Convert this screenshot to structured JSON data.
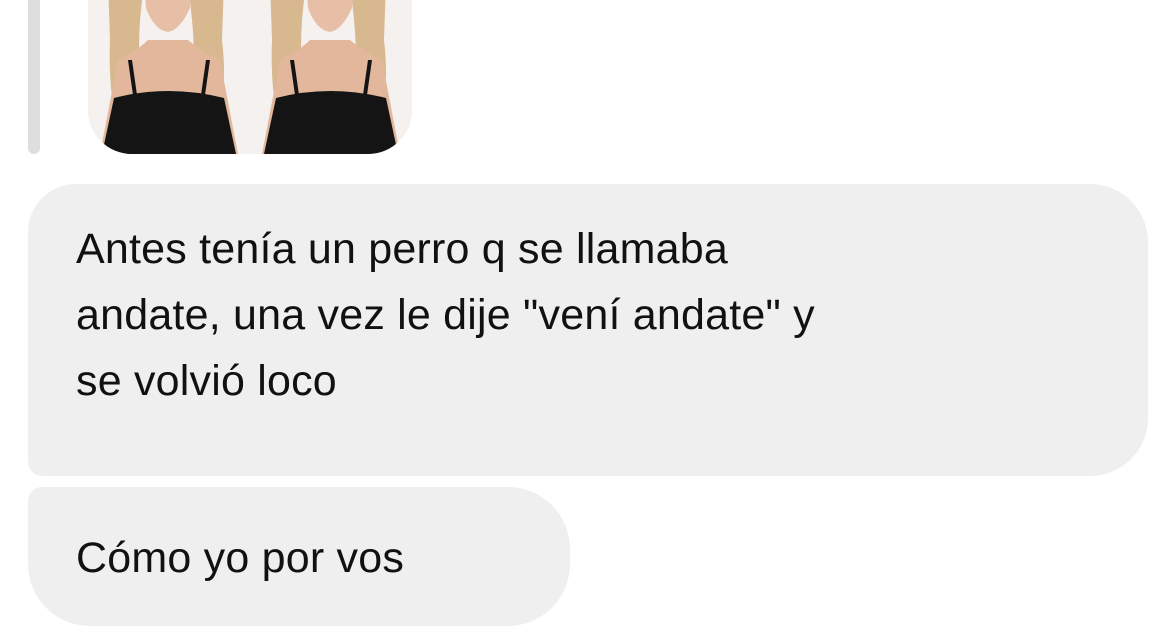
{
  "conversation": {
    "attachment": {
      "icon": "photo-icon"
    },
    "messages": [
      {
        "lines": [
          "Antes tenía un perro q se llamaba",
          "andate, una vez le dije \"vení andate\" y",
          "se volvió loco"
        ]
      },
      {
        "lines": [
          "Cómo yo por vos"
        ]
      }
    ]
  },
  "colors": {
    "bubble_background": "#efefef",
    "text": "#111111",
    "reply_bar": "#dedede",
    "page_background": "#ffffff"
  }
}
